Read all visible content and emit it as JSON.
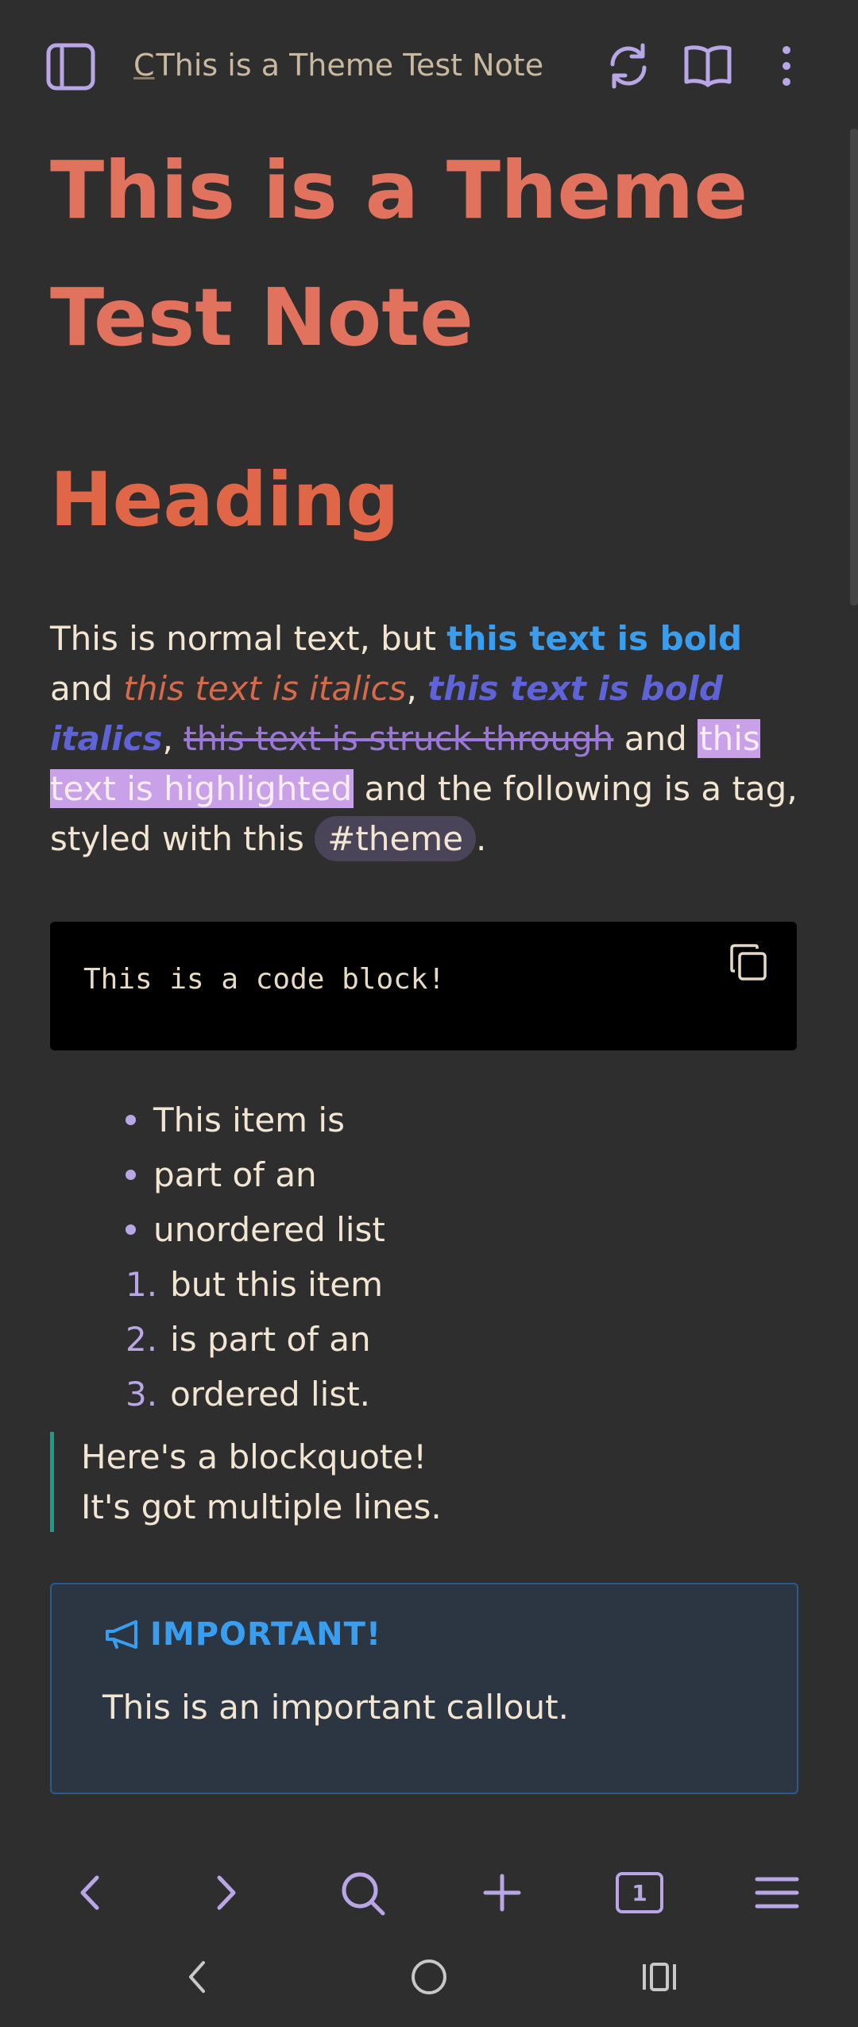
{
  "topbar": {
    "cursor_char": "C",
    "title": "This is a Theme Test Note"
  },
  "note": {
    "title_line1": "This is a Theme",
    "title_line2": "Test Note",
    "heading": "Heading",
    "para": {
      "p1": "This is normal text, but ",
      "bold": "this text is bold",
      "p2": " and ",
      "italic": "this text is italics",
      "p3": ", ",
      "bold_italic": "this text is bold italics",
      "p4": ", ",
      "strike": "this text is struck through",
      "p5": " and ",
      "highlight": "this text is highlighted",
      "p6": " and the following is a tag, styled with this ",
      "tag": "#theme",
      "p7": "."
    },
    "code": "This is a code block!",
    "unordered": [
      "This item is",
      "part of an",
      "unordered list"
    ],
    "ordered": [
      {
        "num": "1.",
        "text": "but this item"
      },
      {
        "num": "2.",
        "text": "is part of an"
      },
      {
        "num": "3.",
        "text": "ordered list."
      }
    ],
    "quote": [
      "Here's a blockquote!",
      "It's got multiple lines."
    ],
    "callout": {
      "title": "IMPORTANT!",
      "body": "This is an important callout."
    }
  },
  "bottom_nav": {
    "tab_count": "1"
  },
  "colors": {
    "accent": "#b9a6e6",
    "title": "#e0725e",
    "bold": "#3a9ef0",
    "background": "#2e2e2e"
  }
}
